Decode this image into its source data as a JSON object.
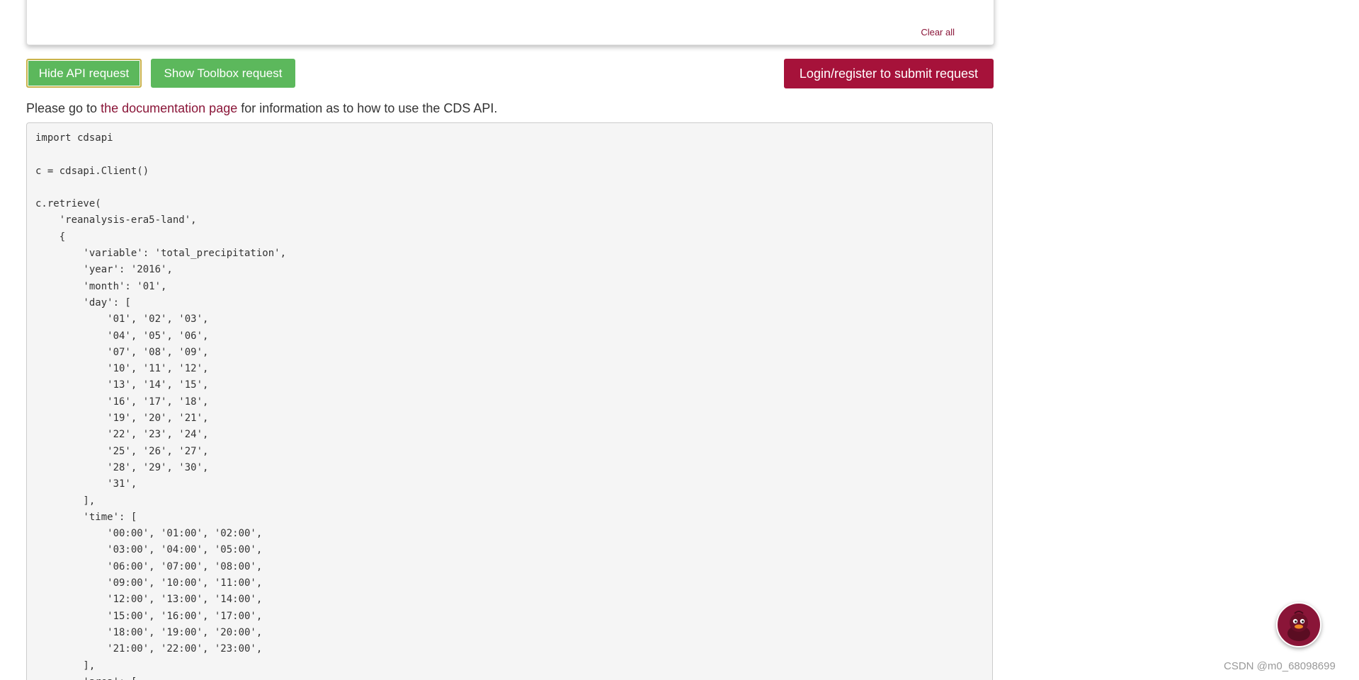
{
  "top_panel": {
    "clear_all_label": "Clear all"
  },
  "buttons": {
    "hide_api_label": "Hide API request",
    "show_toolbox_label": "Show Toolbox request",
    "login_label": "Login/register to submit request"
  },
  "info": {
    "prefix": "Please go to ",
    "link_text": "the documentation page",
    "suffix": " for information as to how to use the CDS API."
  },
  "code": {
    "text": "import cdsapi\n\nc = cdsapi.Client()\n\nc.retrieve(\n    'reanalysis-era5-land',\n    {\n        'variable': 'total_precipitation',\n        'year': '2016',\n        'month': '01',\n        'day': [\n            '01', '02', '03',\n            '04', '05', '06',\n            '07', '08', '09',\n            '10', '11', '12',\n            '13', '14', '15',\n            '16', '17', '18',\n            '19', '20', '21',\n            '22', '23', '24',\n            '25', '26', '27',\n            '28', '29', '30',\n            '31',\n        ],\n        'time': [\n            '00:00', '01:00', '02:00',\n            '03:00', '04:00', '05:00',\n            '06:00', '07:00', '08:00',\n            '09:00', '10:00', '11:00',\n            '12:00', '13:00', '14:00',\n            '15:00', '16:00', '17:00',\n            '18:00', '19:00', '20:00',\n            '21:00', '22:00', '23:00',\n        ],\n        'area': ["
  },
  "mascot": {
    "icon": "duck-mascot-icon"
  },
  "watermark": {
    "text": "CSDN @m0_68098699"
  },
  "colors": {
    "green_button": "#5cb85c",
    "login_button": "#a6123a",
    "link": "#8a1538",
    "code_bg": "#f5f5f5"
  }
}
